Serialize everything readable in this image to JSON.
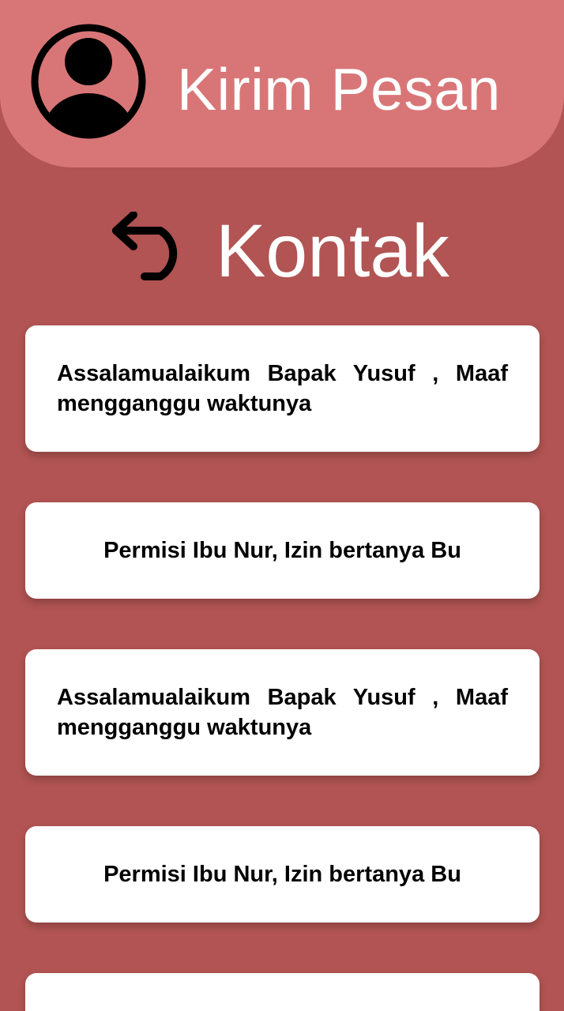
{
  "header": {
    "title": "Kirim Pesan",
    "avatar_icon": "user-avatar-icon",
    "background": "#d87677"
  },
  "page": {
    "title": "Kontak",
    "back_icon": "undo-arrow-icon",
    "background": "#b15453"
  },
  "messages": [
    {
      "text": "Assalamualaikum Bapak Yusuf , Maaf mengganggu waktunya"
    },
    {
      "text": "Permisi Ibu Nur, Izin bertanya Bu"
    },
    {
      "text": "Assalamualaikum Bapak Yusuf , Maaf mengganggu waktunya"
    },
    {
      "text": "Permisi Ibu Nur, Izin bertanya Bu"
    },
    {
      "text": ""
    }
  ]
}
